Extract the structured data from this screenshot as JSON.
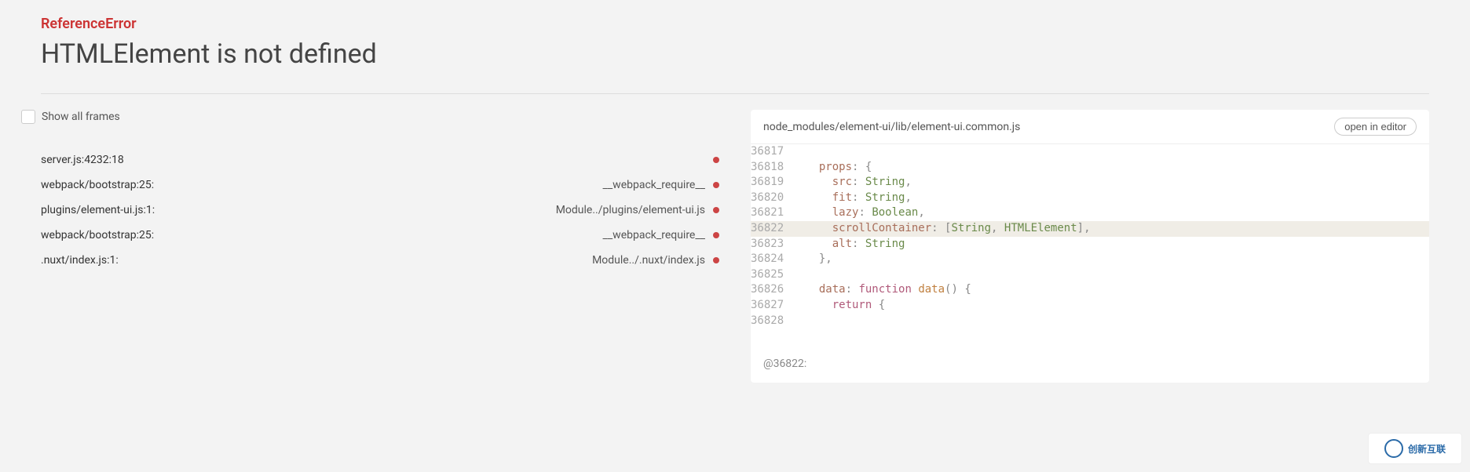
{
  "error": {
    "type": "ReferenceError",
    "message": "HTMLElement is not defined"
  },
  "controls": {
    "show_all_frames": "Show all frames",
    "open_editor": "open in editor"
  },
  "frames": [
    {
      "left": "server.js:4232:18",
      "right": ""
    },
    {
      "left": "webpack/bootstrap:25:",
      "right": "__webpack_require__"
    },
    {
      "left": "plugins/element-ui.js:1:",
      "right": "Module../plugins/element-ui.js"
    },
    {
      "left": "webpack/bootstrap:25:",
      "right": "__webpack_require__"
    },
    {
      "left": ".nuxt/index.js:1:",
      "right": "Module../.nuxt/index.js"
    }
  ],
  "code": {
    "file_path": "node_modules/element-ui/lib/element-ui.common.js",
    "footer": "@36822:",
    "highlight_line": 36822,
    "lines": [
      {
        "no": 36817,
        "indent": 0,
        "tokens": []
      },
      {
        "no": 36818,
        "indent": 2,
        "tokens": [
          {
            "t": "props",
            "c": "tok-key"
          },
          {
            "t": ":",
            "c": "tok-punct"
          },
          {
            "t": " ",
            "c": ""
          },
          {
            "t": "{",
            "c": "tok-punct"
          }
        ]
      },
      {
        "no": 36819,
        "indent": 4,
        "tokens": [
          {
            "t": "src",
            "c": "tok-key"
          },
          {
            "t": ":",
            "c": "tok-punct"
          },
          {
            "t": " ",
            "c": ""
          },
          {
            "t": "String",
            "c": "tok-type"
          },
          {
            "t": ",",
            "c": "tok-punct"
          }
        ]
      },
      {
        "no": 36820,
        "indent": 4,
        "tokens": [
          {
            "t": "fit",
            "c": "tok-key"
          },
          {
            "t": ":",
            "c": "tok-punct"
          },
          {
            "t": " ",
            "c": ""
          },
          {
            "t": "String",
            "c": "tok-type"
          },
          {
            "t": ",",
            "c": "tok-punct"
          }
        ]
      },
      {
        "no": 36821,
        "indent": 4,
        "tokens": [
          {
            "t": "lazy",
            "c": "tok-key"
          },
          {
            "t": ":",
            "c": "tok-punct"
          },
          {
            "t": " ",
            "c": ""
          },
          {
            "t": "Boolean",
            "c": "tok-type"
          },
          {
            "t": ",",
            "c": "tok-punct"
          }
        ]
      },
      {
        "no": 36822,
        "indent": 4,
        "tokens": [
          {
            "t": "scrollContainer",
            "c": "tok-key"
          },
          {
            "t": ":",
            "c": "tok-punct"
          },
          {
            "t": " ",
            "c": ""
          },
          {
            "t": "[",
            "c": "tok-punct"
          },
          {
            "t": "String",
            "c": "tok-type"
          },
          {
            "t": ",",
            "c": "tok-punct"
          },
          {
            "t": " ",
            "c": ""
          },
          {
            "t": "HTMLElement",
            "c": "tok-type"
          },
          {
            "t": "]",
            "c": "tok-punct"
          },
          {
            "t": ",",
            "c": "tok-punct"
          }
        ]
      },
      {
        "no": 36823,
        "indent": 4,
        "tokens": [
          {
            "t": "alt",
            "c": "tok-key"
          },
          {
            "t": ":",
            "c": "tok-punct"
          },
          {
            "t": " ",
            "c": ""
          },
          {
            "t": "String",
            "c": "tok-type"
          }
        ]
      },
      {
        "no": 36824,
        "indent": 2,
        "tokens": [
          {
            "t": "}",
            "c": "tok-punct"
          },
          {
            "t": ",",
            "c": "tok-punct"
          }
        ]
      },
      {
        "no": 36825,
        "indent": 0,
        "tokens": []
      },
      {
        "no": 36826,
        "indent": 2,
        "tokens": [
          {
            "t": "data",
            "c": "tok-key"
          },
          {
            "t": ":",
            "c": "tok-punct"
          },
          {
            "t": " ",
            "c": ""
          },
          {
            "t": "function",
            "c": "tok-kw"
          },
          {
            "t": " ",
            "c": ""
          },
          {
            "t": "data",
            "c": "tok-fn"
          },
          {
            "t": "(",
            "c": "tok-punct"
          },
          {
            "t": ")",
            "c": "tok-punct"
          },
          {
            "t": " ",
            "c": ""
          },
          {
            "t": "{",
            "c": "tok-punct"
          }
        ]
      },
      {
        "no": 36827,
        "indent": 4,
        "tokens": [
          {
            "t": "return",
            "c": "tok-kw"
          },
          {
            "t": " ",
            "c": ""
          },
          {
            "t": "{",
            "c": "tok-punct"
          }
        ]
      },
      {
        "no": 36828,
        "indent": 0,
        "tokens": []
      }
    ]
  },
  "watermark": {
    "text": "创新互联"
  }
}
